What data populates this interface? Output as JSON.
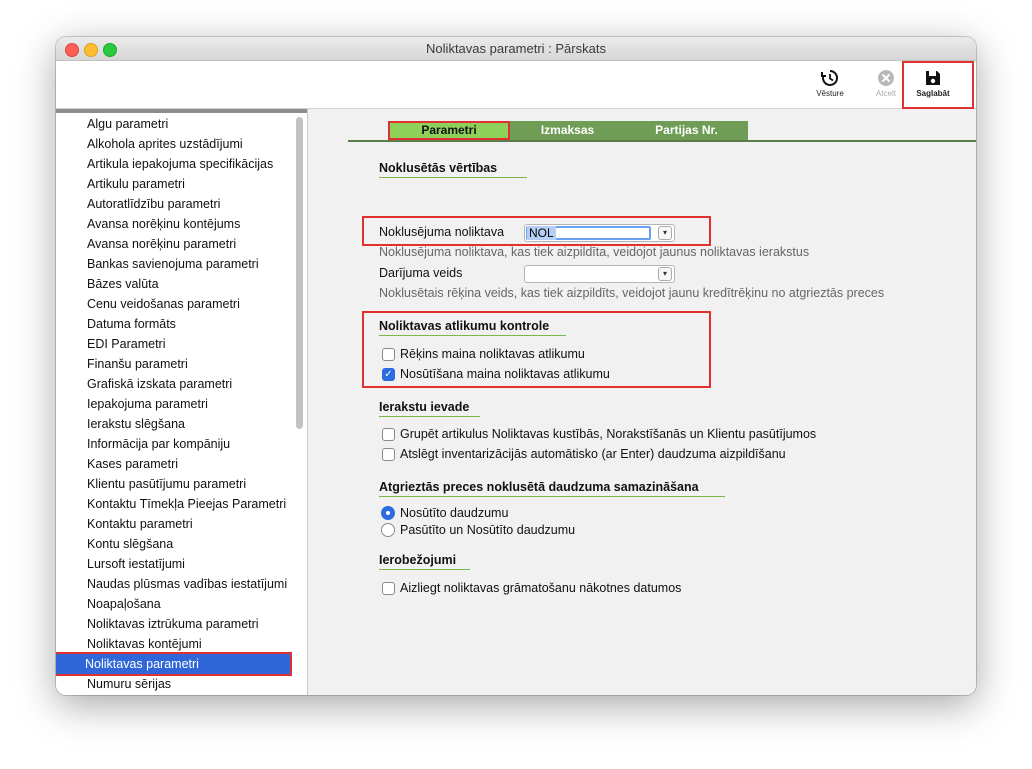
{
  "window": {
    "title": "Noliktavas parametri : Pārskats"
  },
  "toolbar": {
    "history_label": "Vēsture",
    "cancel_label": "Atcelt",
    "save_label": "Saglabāt"
  },
  "sidebar": {
    "items": [
      "Algu parametri",
      "Alkohola aprites uzstādījumi",
      "Artikula iepakojuma specifikācijas",
      "Artikulu parametri",
      "Autoratlīdzību parametri",
      "Avansa norēķinu kontējums",
      "Avansa norēķinu parametri",
      "Bankas savienojuma parametri",
      "Bāzes valūta",
      "Cenu veidošanas parametri",
      "Datuma formāts",
      "EDI Parametri",
      "Finanšu parametri",
      "Grafiskā izskata parametri",
      "Iepakojuma parametri",
      "Ierakstu slēgšana",
      "Informācija par kompāniju",
      "Kases parametri",
      "Klientu pasūtījumu parametri",
      "Kontaktu Tīmekļa Pieejas Parametri",
      "Kontaktu parametri",
      "Kontu slēgšana",
      "Lursoft iestatījumi",
      "Naudas plūsmas vadības iestatījumi",
      "Noapaļošana",
      "Noliktavas iztrūkuma parametri",
      "Noliktavas kontējumi",
      "Noliktavas parametri",
      "Numuru sērijas"
    ],
    "selected": "Noliktavas parametri"
  },
  "tabs": [
    "Parametri",
    "Izmaksas",
    "Partijas Nr."
  ],
  "defaults_section": {
    "heading": "Noklusētās vērtības",
    "warehouse_label": "Noklusējuma noliktava",
    "warehouse_value": "NOL",
    "warehouse_hint": "Noklusējuma noliktava, kas tiek aizpildīta, veidojot jaunus noliktavas ierakstus",
    "transaction_label": "Darījuma veids",
    "transaction_value": "",
    "transaction_hint": "Noklusētais rēķina veids, kas tiek aizpildīts, veidojot jaunu kredītrēķinu no atgrieztās preces"
  },
  "stock_section": {
    "heading": "Noliktavas atlikumu kontrole",
    "invoice_changes": "Rēķins maina noliktavas atlikumu",
    "invoice_changes_checked": false,
    "shipment_changes": "Nosūtīšana maina noliktavas atlikumu",
    "shipment_changes_checked": true
  },
  "entry_section": {
    "heading": "Ierakstu ievade",
    "group_items": "Grupēt artikulus Noliktavas kustībās, Norakstīšanās un Klientu pasūtījumos",
    "group_items_checked": false,
    "disable_autofill": "Atslēgt inventarizācijās automātisko (ar Enter) daudzuma aizpildīšanu",
    "disable_autofill_checked": false
  },
  "returns_section": {
    "heading": "Atgrieztās preces noklusētā daudzuma samazināšana",
    "option_shipped": "Nosūtīto daudzumu",
    "option_ordered_shipped": "Pasūtīto un Nosūtīto daudzumu",
    "selected": "Nosūtīto daudzumu"
  },
  "limits_section": {
    "heading": "Ierobežojumi",
    "forbid_future": "Aizliegt noliktavas grāmatošanu nākotnes datumos",
    "forbid_future_checked": false
  }
}
